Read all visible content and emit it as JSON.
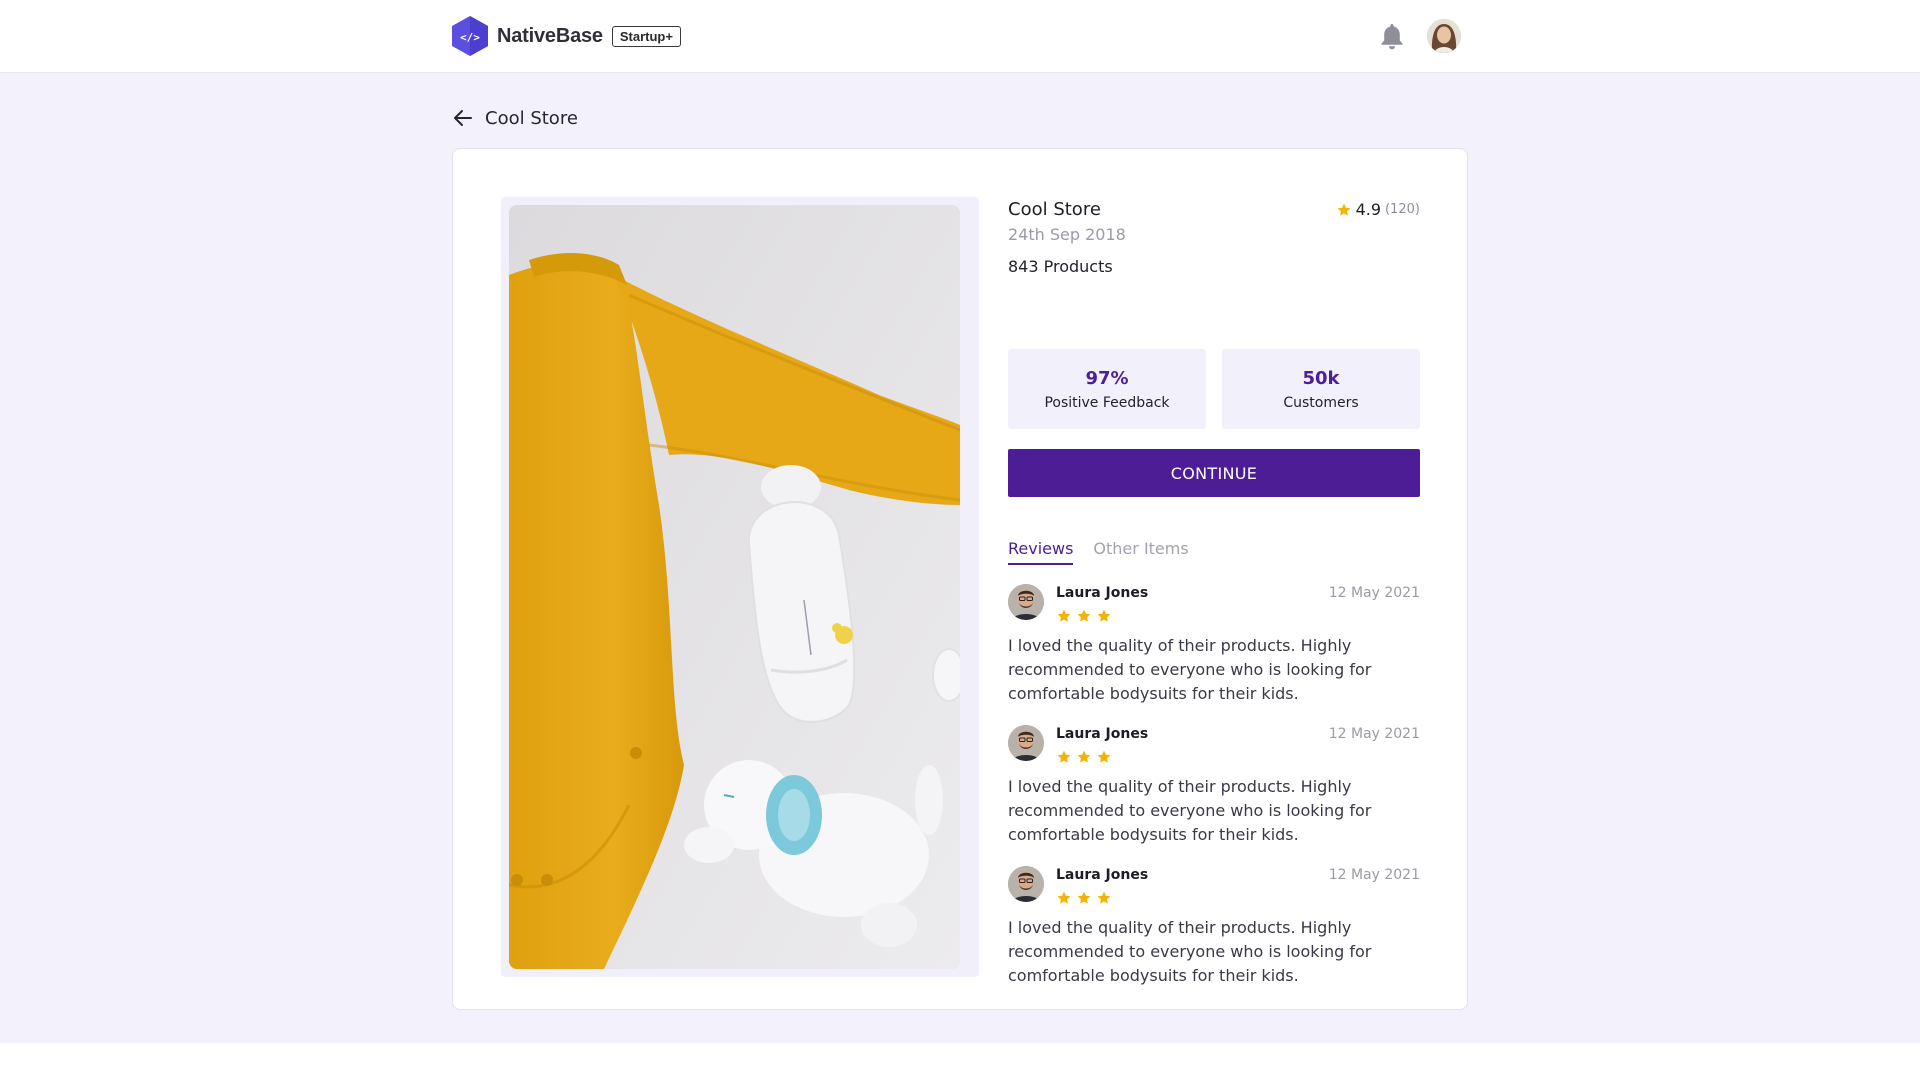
{
  "header": {
    "brand_name": "NativeBase",
    "plan_badge": "Startup+",
    "logo_glyph": "</>",
    "icons": [
      "logo-hex-icon",
      "bell-icon",
      "user-avatar"
    ]
  },
  "page": {
    "back_icon": "arrow-left-icon",
    "title": "Cool Store"
  },
  "store": {
    "name": "Cool Store",
    "date": "24th Sep 2018",
    "products": "843 Products",
    "rating": "4.9",
    "rating_count": "(120)",
    "stats": [
      {
        "value": "97%",
        "label": "Positive Feedback"
      },
      {
        "value": "50k",
        "label": "Customers"
      }
    ],
    "continue_label": "CONTINUE"
  },
  "tabs": [
    {
      "label": "Reviews",
      "active": true
    },
    {
      "label": "Other Items",
      "active": false
    }
  ],
  "reviews": [
    {
      "name": "Laura Jones",
      "date": "12 May 2021",
      "stars": 3,
      "text": "I loved the quality of their products. Highly recommended to everyone who is looking for comfortable bodysuits for their kids."
    },
    {
      "name": "Laura Jones",
      "date": "12 May 2021",
      "stars": 3,
      "text": "I loved the quality of their products. Highly recommended to everyone who is looking for comfortable bodysuits for their kids."
    },
    {
      "name": "Laura Jones",
      "date": "12 May 2021",
      "stars": 3,
      "text": "I loved the quality of their products. Highly recommended to everyone who is looking for comfortable bodysuits for their kids."
    }
  ],
  "colors": {
    "accent": "#4d1d95",
    "star": "#f5b301",
    "page_background": "#f3f2fc",
    "logo": "#5b4fe0"
  }
}
